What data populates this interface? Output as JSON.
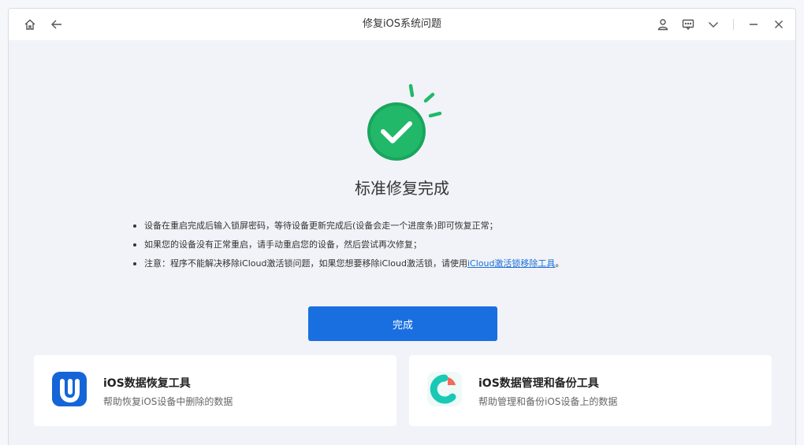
{
  "window": {
    "title": "修复iOS系统问题"
  },
  "titlebar": {
    "left_icons": [
      "home-icon",
      "back-arrow-icon"
    ],
    "right_icons": [
      "user-icon",
      "feedback-icon",
      "chevron-down-icon",
      "minimize-icon",
      "close-icon"
    ]
  },
  "result": {
    "heading": "标准修复完成",
    "notes": [
      "设备在重启完成后输入锁屏密码，等待设备更新完成后(设备会走一个进度条)即可恢复正常；",
      "如果您的设备没有正常重启，请手动重启您的设备，然后尝试再次修复；"
    ],
    "note3_prefix": "注意：程序不能解决移除iCloud激活锁问题，如果您想要移除iCloud激活锁，请使用",
    "note3_link": "iCloud激活锁移除工具",
    "note3_suffix": "。"
  },
  "done_button": {
    "label": "完成"
  },
  "cards": [
    {
      "title": "iOS数据恢复工具",
      "subtitle": "帮助恢复iOS设备中删除的数据",
      "icon": "data-recovery-logo"
    },
    {
      "title": "iOS数据管理和备份工具",
      "subtitle": "帮助管理和备份iOS设备上的数据",
      "icon": "data-manager-logo"
    }
  ],
  "colors": {
    "accent": "#1a6fe0",
    "success": "#1fb36a",
    "link": "#1a6fd6",
    "recovery_logo": "#1565d8",
    "manager_logo_teal": "#19c9b4",
    "manager_logo_coral": "#f26b5b"
  }
}
